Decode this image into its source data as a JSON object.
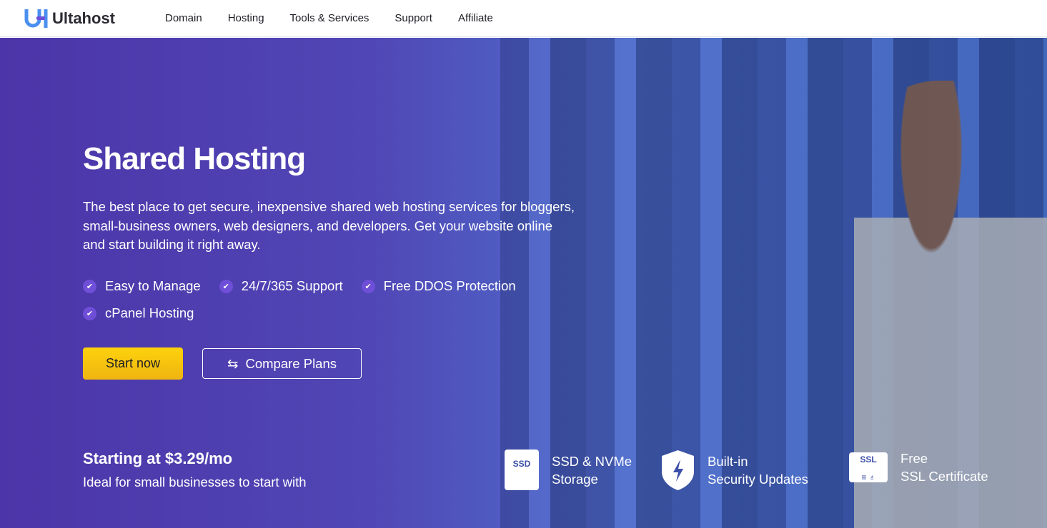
{
  "nav": {
    "brand": "Ultahost",
    "items": [
      "Domain",
      "Hosting",
      "Tools & Services",
      "Support",
      "Affiliate"
    ]
  },
  "hero": {
    "title": "Shared Hosting",
    "description": "The best place to get secure, inexpensive shared web hosting services for bloggers, small-business owners, web designers, and developers. Get your website online and start building it right away.",
    "features": [
      "Easy to Manage",
      "24/7/365 Support",
      "Free DDOS Protection",
      "cPanel Hosting"
    ],
    "start_button": "Start now",
    "compare_button": "Compare Plans",
    "price": "Starting at $3.29/mo",
    "price_note": "Ideal for small businesses to start with"
  },
  "badges": [
    {
      "icon": "SSD",
      "line1": "SSD & NVMe",
      "line2": "Storage"
    },
    {
      "icon": "shield-bolt",
      "line1": "Built-in",
      "line2": "Security Updates"
    },
    {
      "icon": "SSL",
      "line1": "Free",
      "line2": "SSL Certificate"
    }
  ]
}
